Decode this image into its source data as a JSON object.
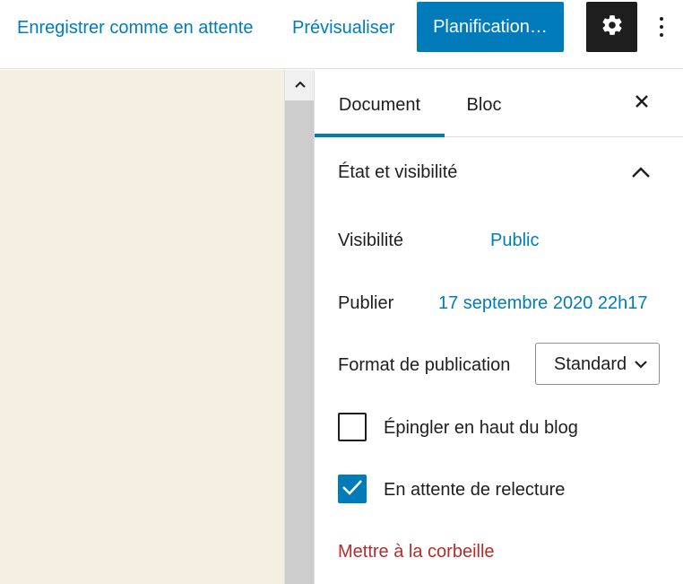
{
  "toolbar": {
    "save_draft_label": "Enregistrer comme en attente",
    "preview_label": "Prévisualiser",
    "schedule_label": "Planification…",
    "settings_icon": "gear-icon",
    "more_icon": "vertical-ellipsis-icon"
  },
  "sidebar": {
    "tabs": [
      {
        "label": "Document",
        "active": true
      },
      {
        "label": "Bloc",
        "active": false
      }
    ],
    "close_icon": "close-icon",
    "panel": {
      "title": "État et visibilité",
      "expanded": true,
      "visibility": {
        "label": "Visibilité",
        "value": "Public"
      },
      "publish": {
        "label": "Publier",
        "value": "17 septembre 2020 22h17"
      },
      "format": {
        "label": "Format de publication",
        "selected": "Standard"
      },
      "sticky": {
        "label": "Épingler en haut du blog",
        "checked": false
      },
      "pending": {
        "label": "En attente de relecture",
        "checked": true
      },
      "trash_label": "Mettre à la corbeille"
    }
  },
  "colors": {
    "accent": "#007cba",
    "canvas_bg": "#f4efe1",
    "danger": "#b32d2e",
    "dark_button": "#1e1e1e"
  }
}
